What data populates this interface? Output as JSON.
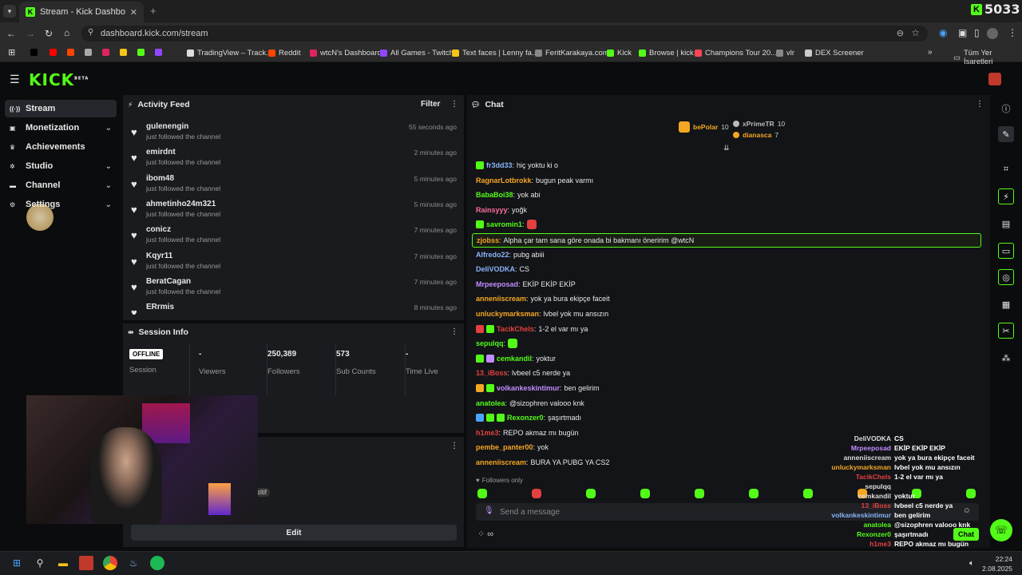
{
  "browser": {
    "tab_title": "Stream - Kick Dashboard",
    "url": "dashboard.kick.com/stream",
    "viewer_counter": "5033",
    "bookmarks": [
      {
        "label": "",
        "color": "#000000"
      },
      {
        "label": "",
        "color": "#ff0000"
      },
      {
        "label": "",
        "color": "#ff4500"
      },
      {
        "label": "",
        "color": "#aaaaaa"
      },
      {
        "label": "",
        "color": "#e0245e"
      },
      {
        "label": "",
        "color": "#f5c518"
      },
      {
        "label": "",
        "color": "#53fc18"
      },
      {
        "label": "",
        "color": "#9146ff"
      },
      {
        "label": "TradingView – Track...",
        "color": "#dddddd"
      },
      {
        "label": "Reddit",
        "color": "#ff4500"
      },
      {
        "label": "wtcN's Dashboard",
        "color": "#e0245e"
      },
      {
        "label": "All Games - Twitch",
        "color": "#9146ff"
      },
      {
        "label": "Text faces | Lenny fa...",
        "color": "#f5c518"
      },
      {
        "label": "FeritKarakaya.com",
        "color": "#888888"
      },
      {
        "label": "Kick",
        "color": "#53fc18"
      },
      {
        "label": "Browse | kick",
        "color": "#53fc18"
      },
      {
        "label": "Champions Tour 20...",
        "color": "#ff4655"
      },
      {
        "label": "vlr",
        "color": "#888888"
      },
      {
        "label": "DEX Screener",
        "color": "#cccccc"
      }
    ],
    "bookmarks_folder": "Tüm Yer İşaretleri"
  },
  "kick": {
    "logo": "KICK",
    "beta": "BETA"
  },
  "sidebar": {
    "items": [
      {
        "label": "Stream",
        "icon": "stream-icon",
        "chev": false,
        "active": true
      },
      {
        "label": "Monetization",
        "icon": "wallet-icon",
        "chev": true
      },
      {
        "label": "Achievements",
        "icon": "trophy-icon",
        "chev": false
      },
      {
        "label": "Studio",
        "icon": "studio-icon",
        "chev": true
      },
      {
        "label": "Channel",
        "icon": "channel-icon",
        "chev": true
      },
      {
        "label": "Settings",
        "icon": "gear-icon",
        "chev": true
      }
    ]
  },
  "activity": {
    "title": "Activity Feed",
    "filter": "Filter",
    "rows": [
      {
        "name": "gulenengin",
        "sub": "just followed the channel",
        "time": "55 seconds ago"
      },
      {
        "name": "emirdnt",
        "sub": "just followed the channel",
        "time": "2 minutes ago"
      },
      {
        "name": "ibom48",
        "sub": "just followed the channel",
        "time": "5 minutes ago"
      },
      {
        "name": "ahmetinho24m321",
        "sub": "just followed the channel",
        "time": "5 minutes ago"
      },
      {
        "name": "conicz",
        "sub": "just followed the channel",
        "time": "7 minutes ago"
      },
      {
        "name": "Kqyr11",
        "sub": "just followed the channel",
        "time": "7 minutes ago"
      },
      {
        "name": "BeratCagan",
        "sub": "just followed the channel",
        "time": "7 minutes ago"
      },
      {
        "name": "ERrmis",
        "sub": "just followed the channel",
        "time": "8 minutes ago"
      }
    ]
  },
  "session": {
    "title": "Session Info",
    "offline_badge": "OFFLINE",
    "cols": [
      {
        "value": "",
        "label": "Session"
      },
      {
        "value": "-",
        "label": "Viewers"
      },
      {
        "value": "250,389",
        "label": "Followers"
      },
      {
        "value": "573",
        "label": "Sub Counts"
      },
      {
        "value": "-",
        "label": "Time Live"
      }
    ]
  },
  "third_panel": {
    "edit": "Edit",
    "partial": "zitif"
  },
  "chat": {
    "title": "Chat",
    "top": [
      {
        "name": "bePolar",
        "count": "10",
        "color": "#f5a623"
      },
      {
        "name": "xPrimeTR",
        "count": "10",
        "color": "#bbbbbb"
      },
      {
        "name": "dianasca",
        "count": "7",
        "color": "#f5a623"
      }
    ],
    "messages": [
      {
        "user": "fr3dd33",
        "color": "#8ab4f8",
        "text": "hiç yoktu ki o",
        "badges": [
          "#53fc18"
        ]
      },
      {
        "user": "RagnarLotbrokk",
        "color": "#f5a623",
        "text": "bugun peak varmı",
        "badges": []
      },
      {
        "user": "BabaBoi38",
        "color": "#53fc18",
        "text": "yok abi",
        "badges": []
      },
      {
        "user": "Rainsyyy",
        "color": "#ff6b9d",
        "text": "yoğk",
        "badges": []
      },
      {
        "user": "savromin1",
        "color": "#53fc18",
        "text": "",
        "badges": [
          "#53fc18"
        ],
        "emote": "#e34040"
      },
      {
        "user": "zjobss",
        "color": "#f5a623",
        "text": "Alpha çar tam sana göre onada bi bakmanı öneririm @wtcN",
        "badges": [],
        "highlight": true
      },
      {
        "user": "Alfredo22",
        "color": "#8ab4f8",
        "text": "pubg abiii",
        "badges": []
      },
      {
        "user": "DeliVODKA",
        "color": "#8ab4f8",
        "text": "CS",
        "badges": []
      },
      {
        "user": "Mrpeeposad",
        "color": "#c18cff",
        "text": "EKİP EKİP EKİP",
        "badges": []
      },
      {
        "user": "anneniiscream",
        "color": "#f5a623",
        "text": "yok ya bura ekipçe faceit",
        "badges": []
      },
      {
        "user": "unluckymarksman",
        "color": "#f5a623",
        "text": "lvbel yok mu ansızın",
        "badges": []
      },
      {
        "user": "TacikChels",
        "color": "#e34040",
        "text": "1-2 el var mı ya",
        "badges": [
          "#e34040",
          "#53fc18"
        ]
      },
      {
        "user": "sepulqq",
        "color": "#53fc18",
        "text": "",
        "badges": [],
        "emote": "#53fc18"
      },
      {
        "user": "cemkandil",
        "color": "#53fc18",
        "text": "yoktur",
        "badges": [
          "#53fc18",
          "#c18cff"
        ]
      },
      {
        "user": "13_iBoss",
        "color": "#e34040",
        "text": "lvbeel c5 nerde ya",
        "badges": []
      },
      {
        "user": "volkankeskintimur",
        "color": "#c18cff",
        "text": "ben gelirim",
        "badges": [
          "#f5a623",
          "#53fc18"
        ]
      },
      {
        "user": "anatolea",
        "color": "#53fc18",
        "text": "@sizophren valooo knk",
        "badges": []
      },
      {
        "user": "Rexonzer0",
        "color": "#53fc18",
        "text": "şaşırtmadı",
        "badges": [
          "#4aa3ff",
          "#53fc18",
          "#53fc18"
        ]
      },
      {
        "user": "h1me3",
        "color": "#e34040",
        "text": "REPO akmaz mı bugün",
        "badges": []
      },
      {
        "user": "pembe_panter00",
        "color": "#f5a623",
        "text": "yok",
        "badges": []
      },
      {
        "user": "anneniiscream",
        "color": "#f5a623",
        "text": "BURA YA PUBG YA CS2",
        "badges": []
      }
    ],
    "followers_only": "Followers only",
    "placeholder": "Send a message",
    "overlay": [
      {
        "user": "DeliVODKA",
        "color": "#dddddd",
        "text": "CS"
      },
      {
        "user": "Mrpeeposad",
        "color": "#c18cff",
        "text": "EKİP EKİP EKİP"
      },
      {
        "user": "anneniiscream",
        "color": "#dddddd",
        "text": "yok ya bura ekipçe faceit"
      },
      {
        "user": "unluckymarksman",
        "color": "#f5a623",
        "text": "lvbel yok mu ansızın"
      },
      {
        "user": "TacikChels",
        "color": "#e34040",
        "text": "1-2 el var mı ya"
      },
      {
        "user": "sepulqq",
        "color": "#dddddd",
        "text": ""
      },
      {
        "user": "cemkandil",
        "color": "#dddddd",
        "text": "yoktur"
      },
      {
        "user": "13_iBoss",
        "color": "#e34040",
        "text": "lvbeel c5 nerde ya"
      },
      {
        "user": "volkankeskintimur",
        "color": "#8ab4f8",
        "text": "ben gelirim"
      },
      {
        "user": "anatolea",
        "color": "#53fc18",
        "text": "@sizophren valooo knk"
      },
      {
        "user": "Rexonzer0",
        "color": "#53fc18",
        "text": "şaşırtmadı"
      },
      {
        "user": "h1me3",
        "color": "#e34040",
        "text": "REPO akmaz mı bugün"
      },
      {
        "user": "pembe_panter00",
        "color": "#dddddd",
        "text": "yok"
      },
      {
        "user": "anneniiscream",
        "color": "#dddddd",
        "text": "BURA YA PUBG YA CS2"
      }
    ],
    "chat_button": "Chat"
  },
  "taskbar": {
    "time": "22:24",
    "date": "2.08.2025"
  }
}
